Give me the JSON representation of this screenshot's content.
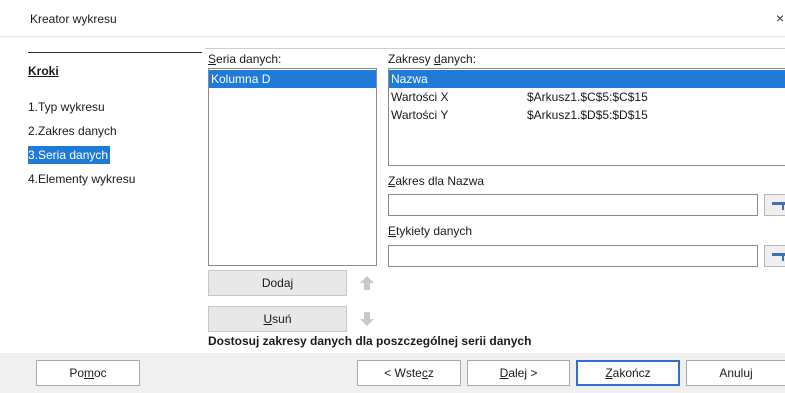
{
  "window": {
    "title": "Kreator wykresu",
    "close_glyph": "×"
  },
  "steps": {
    "heading": "Kroki",
    "items": [
      {
        "label": "1.Typ wykresu"
      },
      {
        "label": "2.Zakres danych"
      },
      {
        "label": "3.Seria danych",
        "active": true
      },
      {
        "label": "4.Elementy wykresu"
      }
    ]
  },
  "series": {
    "label_pre": "S",
    "label_post": "eria danych:",
    "items": [
      "Kolumna D"
    ]
  },
  "ranges": {
    "label_pre": "Zakresy ",
    "label_u": "d",
    "label_post": "anych:",
    "rows": [
      {
        "role": "Nazwa",
        "range": ""
      },
      {
        "role": "Wartości X",
        "range": "$Arkusz1.$C$5:$C$15"
      },
      {
        "role": "Wartości Y",
        "range": "$Arkusz1.$D$5:$D$15"
      }
    ]
  },
  "range_for": {
    "label_u": "Z",
    "label_post": "akres dla Nazwa",
    "value": ""
  },
  "labels_range": {
    "label_u": "E",
    "label_post": "tykiety danych",
    "value": ""
  },
  "buttons": {
    "add_pre": "Doda",
    "add_u": "j",
    "add_post": "",
    "remove_pre": "",
    "remove_u": "U",
    "remove_post": "suń",
    "help_pre": "Po",
    "help_u": "m",
    "help_post": "oc",
    "back_pre": "< Wste",
    "back_u": "c",
    "back_post": "z",
    "next_pre": "",
    "next_u": "D",
    "next_post": "alej >",
    "finish_pre": "",
    "finish_u": "Z",
    "finish_post": "akończ",
    "cancel": "Anuluj"
  },
  "hint": "Dostosuj zakresy danych dla poszczególnej serii danych",
  "colors": {
    "accent": "#1f7ad8",
    "default_border": "#2f6fd1"
  },
  "icons": {
    "up": "arrow-up-icon",
    "down": "arrow-down-icon",
    "picker": "range-picker-icon"
  }
}
